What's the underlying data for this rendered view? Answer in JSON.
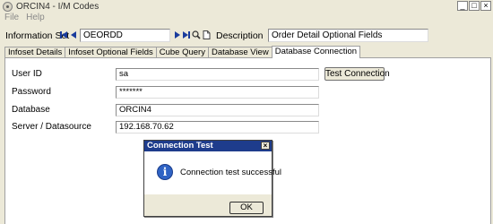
{
  "window": {
    "title": "ORCIN4 - I/M Codes",
    "controls": [
      "_",
      "□",
      "×"
    ]
  },
  "menu": [
    "File",
    "Help"
  ],
  "infoset": {
    "label": "Information Set",
    "value": "OEORDD",
    "description_label": "Description",
    "description_value": "Order Detail Optional Fields"
  },
  "tabs": [
    {
      "label": "Infoset Details",
      "active": false
    },
    {
      "label": "Infoset Optional Fields",
      "active": false
    },
    {
      "label": "Cube Query",
      "active": false
    },
    {
      "label": "Database View",
      "active": false
    },
    {
      "label": "Database Connection",
      "active": true
    }
  ],
  "connection": {
    "user_id_label": "User ID",
    "user_id_value": "sa",
    "password_label": "Password",
    "password_value": "*******",
    "database_label": "Database",
    "database_value": "ORCIN4",
    "server_label": "Server / Datasource",
    "server_value": "192.168.70.62",
    "test_button": "Test Connection"
  },
  "dialog": {
    "title": "Connection Test",
    "message": "Connection test successful",
    "ok_label": "OK",
    "icon": "info-icon",
    "close": "×"
  }
}
